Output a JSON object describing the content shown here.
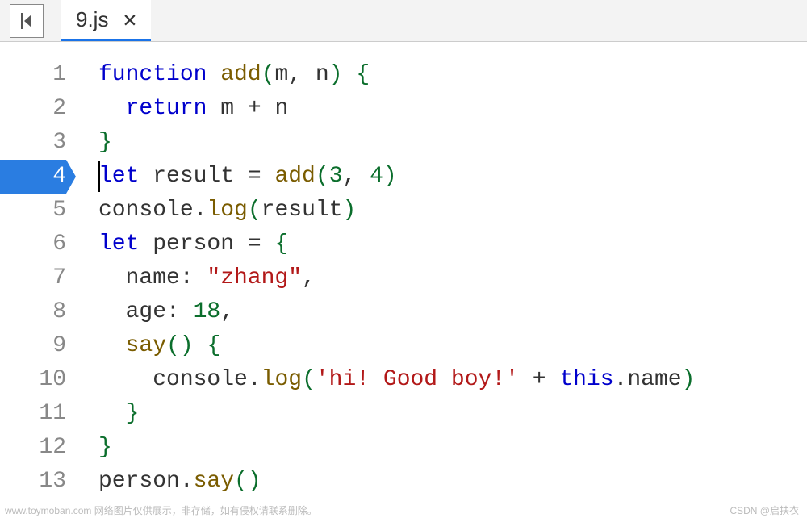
{
  "tab": {
    "filename": "9.js",
    "close": "✕"
  },
  "activeLine": 4,
  "lines": [
    {
      "num": "1",
      "tokens": [
        {
          "t": "function",
          "c": "kw"
        },
        {
          "t": " ",
          "c": "plain"
        },
        {
          "t": "add",
          "c": "fn"
        },
        {
          "t": "(",
          "c": "paren"
        },
        {
          "t": "m",
          "c": "plain"
        },
        {
          "t": ", ",
          "c": "plain"
        },
        {
          "t": "n",
          "c": "plain"
        },
        {
          "t": ")",
          "c": "paren"
        },
        {
          "t": " ",
          "c": "plain"
        },
        {
          "t": "{",
          "c": "brace"
        }
      ]
    },
    {
      "num": "2",
      "tokens": [
        {
          "t": "  ",
          "c": "plain"
        },
        {
          "t": "return",
          "c": "kw"
        },
        {
          "t": " m + n",
          "c": "plain"
        }
      ]
    },
    {
      "num": "3",
      "tokens": [
        {
          "t": "}",
          "c": "brace"
        }
      ]
    },
    {
      "num": "4",
      "tokens": [
        {
          "t": "let",
          "c": "kw"
        },
        {
          "t": " result = ",
          "c": "plain"
        },
        {
          "t": "add",
          "c": "fn"
        },
        {
          "t": "(",
          "c": "paren"
        },
        {
          "t": "3",
          "c": "num"
        },
        {
          "t": ", ",
          "c": "plain"
        },
        {
          "t": "4",
          "c": "num"
        },
        {
          "t": ")",
          "c": "paren"
        }
      ]
    },
    {
      "num": "5",
      "tokens": [
        {
          "t": "console.",
          "c": "plain"
        },
        {
          "t": "log",
          "c": "fn"
        },
        {
          "t": "(",
          "c": "paren"
        },
        {
          "t": "result",
          "c": "plain"
        },
        {
          "t": ")",
          "c": "paren"
        }
      ]
    },
    {
      "num": "6",
      "tokens": [
        {
          "t": "let",
          "c": "kw"
        },
        {
          "t": " person = ",
          "c": "plain"
        },
        {
          "t": "{",
          "c": "brace"
        }
      ]
    },
    {
      "num": "7",
      "tokens": [
        {
          "t": "  name: ",
          "c": "plain"
        },
        {
          "t": "\"zhang\"",
          "c": "str"
        },
        {
          "t": ",",
          "c": "plain"
        }
      ]
    },
    {
      "num": "8",
      "tokens": [
        {
          "t": "  age: ",
          "c": "plain"
        },
        {
          "t": "18",
          "c": "num"
        },
        {
          "t": ",",
          "c": "plain"
        }
      ]
    },
    {
      "num": "9",
      "tokens": [
        {
          "t": "  ",
          "c": "plain"
        },
        {
          "t": "say",
          "c": "fn"
        },
        {
          "t": "()",
          "c": "paren"
        },
        {
          "t": " ",
          "c": "plain"
        },
        {
          "t": "{",
          "c": "brace"
        }
      ]
    },
    {
      "num": "10",
      "tokens": [
        {
          "t": "    console.",
          "c": "plain"
        },
        {
          "t": "log",
          "c": "fn"
        },
        {
          "t": "(",
          "c": "paren"
        },
        {
          "t": "'hi! Good boy!'",
          "c": "str"
        },
        {
          "t": " + ",
          "c": "plain"
        },
        {
          "t": "this",
          "c": "kw"
        },
        {
          "t": ".name",
          "c": "plain"
        },
        {
          "t": ")",
          "c": "paren"
        }
      ]
    },
    {
      "num": "11",
      "tokens": [
        {
          "t": "  ",
          "c": "plain"
        },
        {
          "t": "}",
          "c": "brace"
        }
      ]
    },
    {
      "num": "12",
      "tokens": [
        {
          "t": "}",
          "c": "brace"
        }
      ]
    },
    {
      "num": "13",
      "tokens": [
        {
          "t": "person.",
          "c": "plain"
        },
        {
          "t": "say",
          "c": "fn"
        },
        {
          "t": "()",
          "c": "paren"
        }
      ]
    }
  ],
  "watermark": {
    "left": "www.toymoban.com 网络图片仅供展示，非存储，如有侵权请联系删除。",
    "right": "CSDN @启扶衣"
  }
}
